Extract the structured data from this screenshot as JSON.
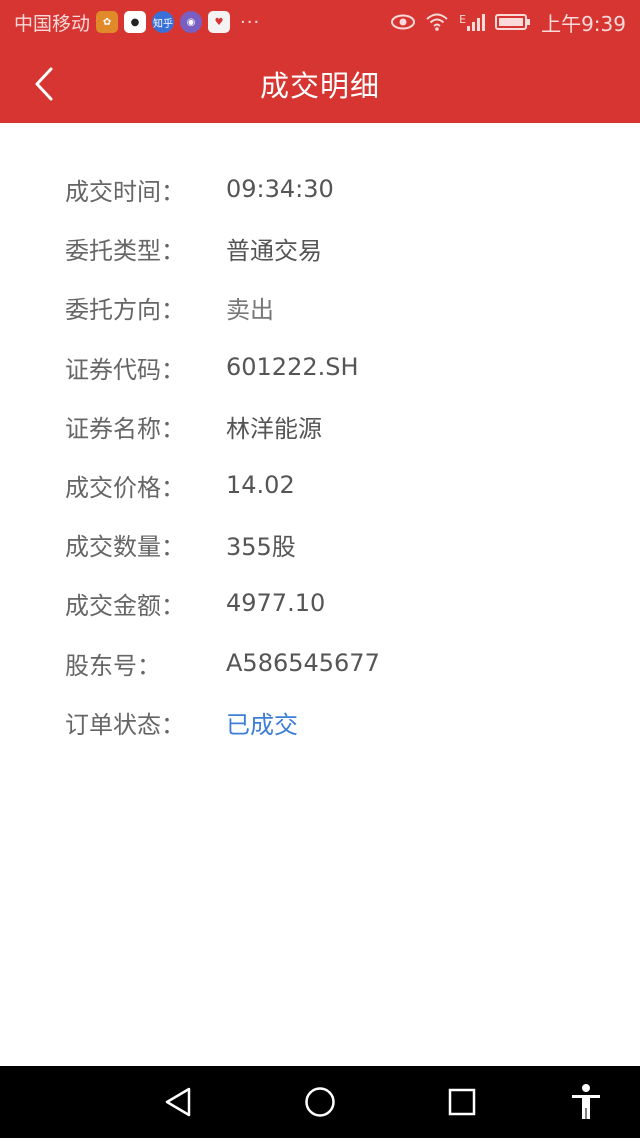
{
  "status_bar": {
    "carrier": "中国移动",
    "notification_icons": [
      "weibo-icon",
      "qq-icon",
      "zhihu-icon",
      "app-icon",
      "app-icon"
    ],
    "zhihu_label": "知乎",
    "more": "···",
    "time": "上午9:39",
    "network_label": "E"
  },
  "header": {
    "title": "成交明细",
    "bg_color": "#d63531"
  },
  "details": [
    {
      "label": "成交时间：",
      "value": "09:34:30"
    },
    {
      "label": "委托类型：",
      "value": "普通交易"
    },
    {
      "label": "委托方向：",
      "value": "卖出"
    },
    {
      "label": "证券代码：",
      "value": "601222.SH"
    },
    {
      "label": "证券名称：",
      "value": "林洋能源"
    },
    {
      "label": "成交价格：",
      "value": "14.02"
    },
    {
      "label": "成交数量：",
      "value": "355股"
    },
    {
      "label": "成交金额：",
      "value": "4977.10"
    },
    {
      "label": "股东号：",
      "value": "A586545677"
    },
    {
      "label": "订单状态：",
      "value": "已成交"
    }
  ],
  "colors": {
    "status_value": "#3d7fd6",
    "label": "#666666"
  }
}
